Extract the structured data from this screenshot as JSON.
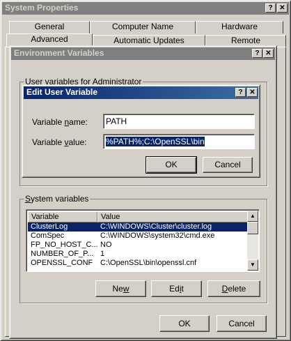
{
  "system_props": {
    "title": "System Properties",
    "help_btn": "?",
    "close_btn": "✕",
    "tabs_row1": [
      "General",
      "Computer Name",
      "Hardware"
    ],
    "tabs_row2": [
      "Advanced",
      "Automatic Updates",
      "Remote"
    ]
  },
  "env_vars": {
    "title": "Environment Variables",
    "help_btn": "?",
    "close_btn": "✕",
    "user_group_label": "User variables for Administrator",
    "system_group_label": "System variables",
    "columns": [
      "Variable",
      "Value"
    ],
    "system_rows": [
      {
        "variable": "ClusterLog",
        "value": "C:\\WINDOWS\\Cluster\\cluster.log"
      },
      {
        "variable": "ComSpec",
        "value": "C:\\WINDOWS\\system32\\cmd.exe"
      },
      {
        "variable": "FP_NO_HOST_C...",
        "value": "NO"
      },
      {
        "variable": "NUMBER_OF_P...",
        "value": "1"
      },
      {
        "variable": "OPENSSL_CONF",
        "value": "C:\\OpenSSL\\bin\\openssl.cnf"
      }
    ],
    "new_label": "New",
    "edit_label": "Edit",
    "delete_label": "Delete",
    "ok_label": "OK",
    "cancel_label": "Cancel"
  },
  "edit_var": {
    "title": "Edit User Variable",
    "help_btn": "?",
    "close_btn": "✕",
    "name_label": "Variable name:",
    "name_value": "PATH",
    "value_label": "Variable value:",
    "value_value": "%PATH%;C:\\OpenSSL\\bin",
    "ok_label": "OK",
    "cancel_label": "Cancel"
  }
}
